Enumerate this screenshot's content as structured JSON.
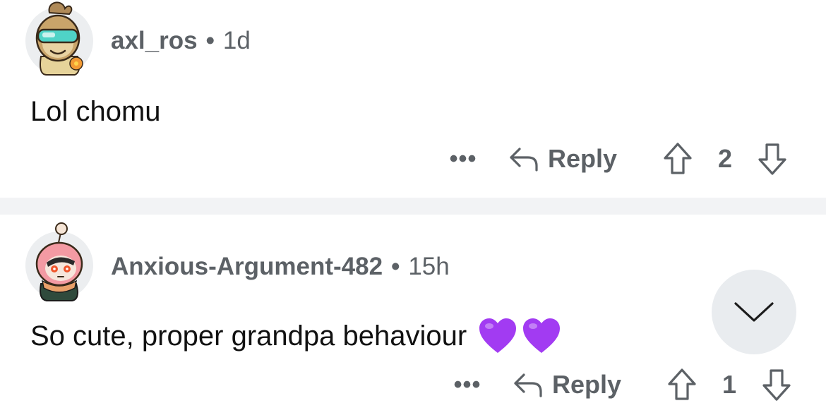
{
  "comments": [
    {
      "username": "axl_ros",
      "separator": "•",
      "time": "1d",
      "body": "Lol chomu",
      "more_label": "•••",
      "reply_label": "Reply",
      "vote_count": "2"
    },
    {
      "username": "Anxious-Argument-482",
      "separator": "•",
      "time": "15h",
      "body": "So cute, proper grandpa behaviour",
      "more_label": "•••",
      "reply_label": "Reply",
      "vote_count": "1"
    }
  ],
  "icons": {
    "reply": "reply-arrow-icon",
    "upvote": "upvote-arrow-icon",
    "downvote": "downvote-arrow-icon",
    "collapse": "chevron-down-icon",
    "heart": "purple-heart-emoji"
  },
  "colors": {
    "meta_text": "#5c6166",
    "heart": "#a23bf2",
    "divider": "#f2f3f5",
    "collapse_bg": "#e9ecef"
  }
}
